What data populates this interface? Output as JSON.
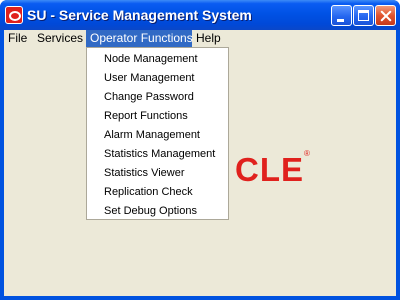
{
  "window": {
    "title": "SU - Service Management System"
  },
  "menubar": {
    "items": [
      {
        "label": "File"
      },
      {
        "label": "Services"
      },
      {
        "label": "Operator Functions"
      },
      {
        "label": "Help"
      }
    ]
  },
  "dropdown": {
    "items": [
      {
        "label": "Node Management"
      },
      {
        "label": "User Management"
      },
      {
        "label": "Change Password"
      },
      {
        "label": "Report Functions"
      },
      {
        "label": "Alarm Management"
      },
      {
        "label": "Statistics Management"
      },
      {
        "label": "Statistics Viewer"
      },
      {
        "label": "Replication Check"
      },
      {
        "label": "Set Debug Options"
      }
    ]
  },
  "logo": {
    "visible_text": "CLE",
    "registered_mark": "®"
  },
  "colors": {
    "titlebar": "#0052e5",
    "menu_highlight": "#316ac5",
    "background": "#ece9d8",
    "logo_red": "#e0211d"
  }
}
